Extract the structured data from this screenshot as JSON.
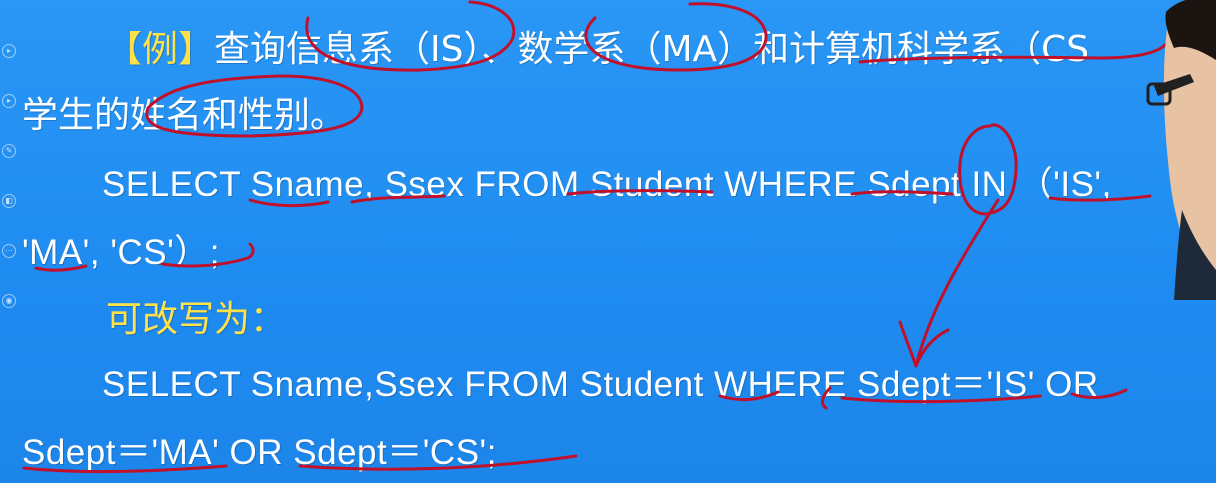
{
  "slide": {
    "example_tag": "【例】",
    "line1_text": "查询信息系（IS）、数学系（MA）和计算机科学系（CS",
    "line2_text": "学生的姓名和性别。",
    "line3_text": "SELECT Sname, Ssex FROM Student WHERE Sdept IN （'IS',",
    "line4_text": "'MA', 'CS'）;",
    "line5_text": "可改写为：",
    "line6_text": "SELECT Sname,Ssex FROM Student WHERE Sdept＝'IS' OR",
    "line7_text": "Sdept＝'MA' OR Sdept＝'CS';"
  },
  "colors": {
    "background": "#1f8cf1",
    "text": "#ffffff",
    "highlight": "#ffe14a",
    "ink": "#c0102a"
  },
  "icons": [
    "play-icon",
    "play-icon",
    "pen-icon",
    "eraser-icon",
    "menu-icon",
    "zoom-icon"
  ]
}
